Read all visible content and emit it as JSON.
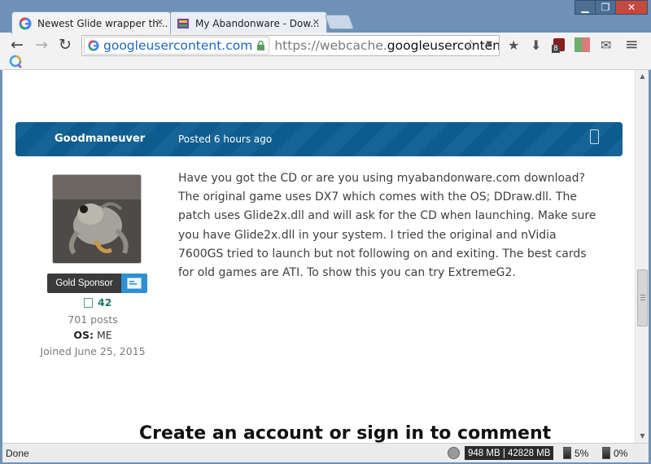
{
  "window": {
    "minimize_label": "▁",
    "maximize_label": "❐",
    "close_label": "✕"
  },
  "tabs": [
    {
      "title": "Newest Glide wrapper th...",
      "close": "✕",
      "active": true,
      "favicon": "google-g-icon"
    },
    {
      "title": "My Abandonware - Dow...",
      "close": "✕",
      "active": false,
      "favicon": "abandonware-icon"
    }
  ],
  "toolbar": {
    "back": "←",
    "forward": "→",
    "reload": "↻",
    "origin_chip": "googleusercontent.com",
    "url_prefix": "https://webcache.",
    "url_host": "googleusercontent.",
    "bookmark_star": "☆",
    "dropdown": "▼",
    "star_filled": "★",
    "download": "⬇",
    "ext_badge": "8",
    "mail": "✉",
    "menu": "≡"
  },
  "post": {
    "author": "Goodmaneuver",
    "posted": "Posted 6 hours ago",
    "body": "Have you got the CD or are you using myabandonware.com download? The original game uses DX7 which comes with the OS; DDraw.dll. The patch uses Glide2x.dll and will ask for the CD when launching. Make sure you have Glide2x.dll in your system. I tried the original and nVidia 7600GS tried to launch but not following on and exiting. The best cards for old games are ATI. To show this you can try ExtremeG2.",
    "badge": "Gold Sponsor",
    "reputation": "42",
    "posts": "701 posts",
    "os_label": "OS:",
    "os_value": "ME",
    "joined": "Joined June 25, 2015"
  },
  "cta": {
    "create_account": "Create an account or sign in to comment"
  },
  "status": {
    "text": "Done",
    "memory": "948 MB | 42828 MB",
    "cpu1": "5%",
    "cpu2": "0%"
  },
  "colors": {
    "chrome_frame": "#6e91b5",
    "post_header": "#0e5e93",
    "reputation": "#1a7b69",
    "badge_accent": "#2d8fd4"
  }
}
